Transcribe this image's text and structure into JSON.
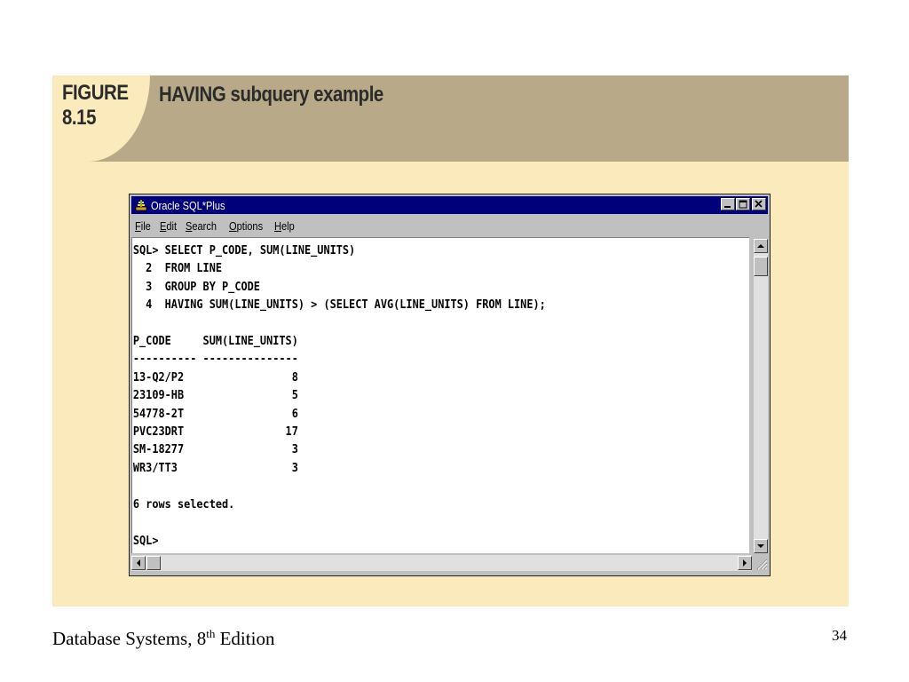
{
  "figure": {
    "label": "FIGURE\n8.15",
    "title": "HAVING subquery example"
  },
  "window": {
    "title": "Oracle SQL*Plus",
    "menu": [
      {
        "accel": "F",
        "rest": "ile"
      },
      {
        "accel": "E",
        "rest": "dit"
      },
      {
        "accel": "S",
        "rest": "earch"
      },
      {
        "accel": "O",
        "rest": "ptions"
      },
      {
        "accel": "H",
        "rest": "elp"
      }
    ],
    "console_text": "SQL> SELECT P_CODE, SUM(LINE_UNITS)\n  2  FROM LINE\n  3  GROUP BY P_CODE\n  4  HAVING SUM(LINE_UNITS) > (SELECT AVG(LINE_UNITS) FROM LINE);\n\nP_CODE     SUM(LINE_UNITS)\n---------- ---------------\n13-Q2/P2                 8\n23109-HB                 5\n54778-2T                 6\nPVC23DRT                17\nSM-18277                 3\nWR3/TT3                  3\n\n6 rows selected.\n\nSQL>"
  },
  "footer": {
    "book_prefix": "Database Systems, 8",
    "book_sup": "th",
    "book_suffix": " Edition",
    "page_number": "34"
  },
  "colors": {
    "panel_bg": "#fbeabc",
    "header_bg": "#b8aa88",
    "titlebar_bg": "#00007b"
  }
}
